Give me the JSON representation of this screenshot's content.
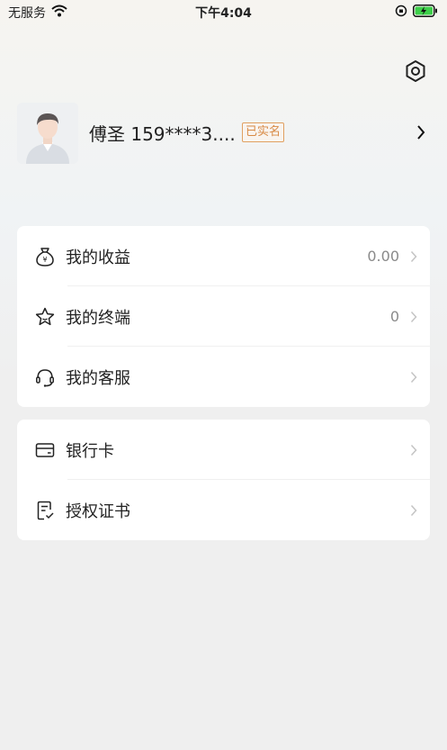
{
  "status_bar": {
    "carrier": "无服务",
    "time": "下午4:04"
  },
  "profile": {
    "name": "傅圣 159****3....",
    "verified_badge": "已实名"
  },
  "menu_main": [
    {
      "label": "我的收益",
      "value": "0.00",
      "icon": "money-bag-icon"
    },
    {
      "label": "我的终端",
      "value": "0",
      "icon": "star-icon"
    },
    {
      "label": "我的客服",
      "value": "",
      "icon": "headset-icon"
    }
  ],
  "menu_secondary": [
    {
      "label": "银行卡",
      "icon": "bank-card-icon"
    },
    {
      "label": "授权证书",
      "icon": "certificate-icon"
    }
  ],
  "colors": {
    "badge": "#d88a45",
    "background": "#efefef"
  }
}
